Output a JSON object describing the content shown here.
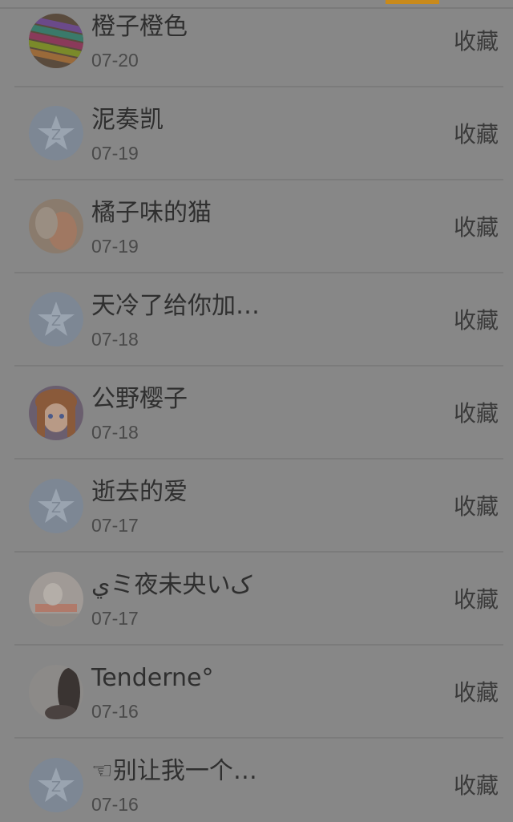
{
  "list": {
    "items": [
      {
        "name": "橙子橙色",
        "date": "07-20",
        "action": "收藏",
        "avatar": "pencils-photo"
      },
      {
        "name": "泥奏凯",
        "date": "07-19",
        "action": "收藏",
        "avatar": "default-star-avatar"
      },
      {
        "name": "橘子味的猫",
        "date": "07-19",
        "action": "收藏",
        "avatar": "portrait-photo"
      },
      {
        "name": "天冷了给你加…",
        "date": "07-18",
        "action": "收藏",
        "avatar": "default-star-avatar"
      },
      {
        "name": "公野樱子",
        "date": "07-18",
        "action": "收藏",
        "avatar": "anime-girl-photo"
      },
      {
        "name": "逝去的爱",
        "date": "07-17",
        "action": "收藏",
        "avatar": "default-star-avatar"
      },
      {
        "name": "ﻱミ夜未央いک",
        "date": "07-17",
        "action": "收藏",
        "avatar": "bunny-photo"
      },
      {
        "name": "Tenderne°",
        "date": "07-16",
        "action": "收藏",
        "avatar": "silhouette-photo"
      },
      {
        "name": "☜别让我一个…",
        "date": "07-16",
        "action": "收藏",
        "avatar": "default-star-avatar"
      }
    ]
  },
  "colors": {
    "overlay_bg": "#878787",
    "accent": "#c98a1b",
    "text": "#2f2f2f"
  }
}
